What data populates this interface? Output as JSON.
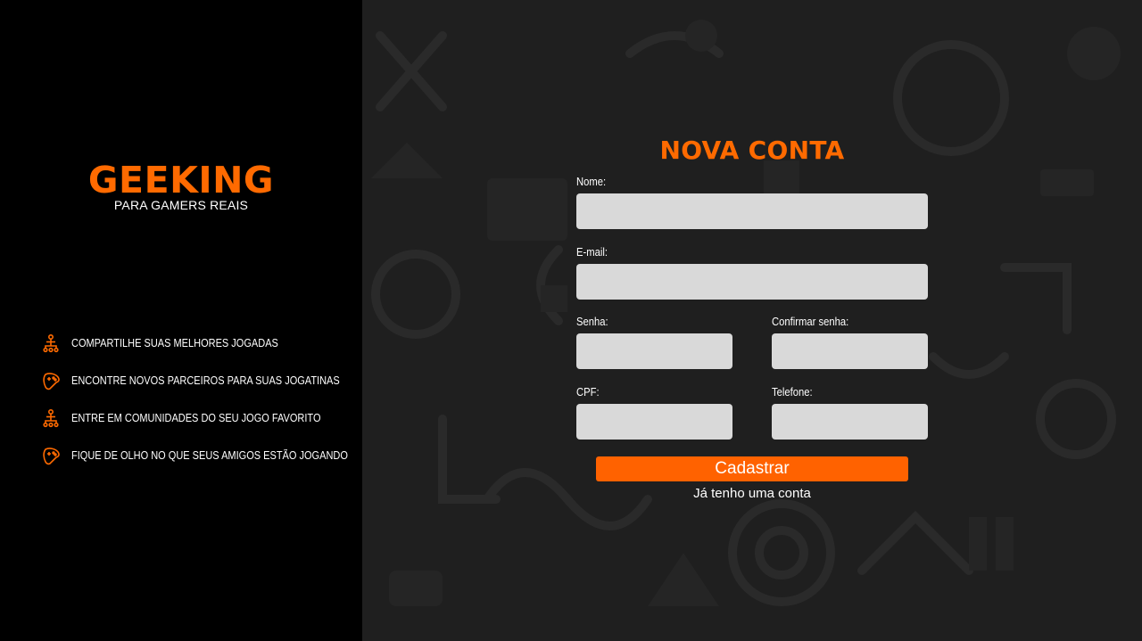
{
  "brand": {
    "title": "GEEKING",
    "subtitle": "PARA GAMERS REAIS"
  },
  "features": [
    {
      "icon": "network-icon",
      "text": "COMPARTILHE SUAS MELHORES JOGADAS"
    },
    {
      "icon": "gamepad-icon",
      "text": "ENCONTRE NOVOS PARCEIROS PARA SUAS JOGATINAS"
    },
    {
      "icon": "network-icon",
      "text": "ENTRE EM COMUNIDADES DO SEU JOGO FAVORITO"
    },
    {
      "icon": "gamepad-icon",
      "text": "FIQUE DE OLHO NO QUE SEUS AMIGOS ESTÃO JOGANDO"
    }
  ],
  "form": {
    "title": "NOVA CONTA",
    "name_label": "Nome:",
    "name_value": "",
    "email_label": "E-mail:",
    "email_value": "",
    "password_label": "Senha:",
    "password_value": "",
    "confirm_label": "Confirmar senha:",
    "confirm_value": "",
    "cpf_label": "CPF:",
    "cpf_value": "",
    "phone_label": "Telefone:",
    "phone_value": "",
    "submit_label": "Cadastrar",
    "login_link": "Já tenho uma conta"
  },
  "colors": {
    "accent": "#ff6a00",
    "sidebar_bg": "#000000",
    "main_bg": "#1f1f1f",
    "input_bg": "#d9d9d9"
  }
}
